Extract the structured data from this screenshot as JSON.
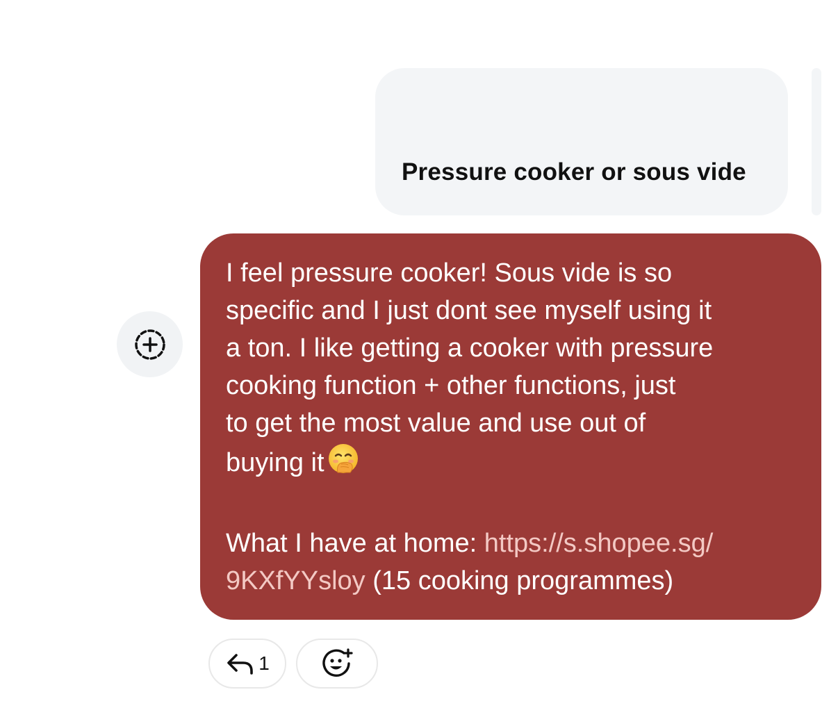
{
  "quoted_message": {
    "text": "Pressure cooker or sous vide"
  },
  "message": {
    "paragraph1_lines": [
      "I feel pressure cooker! Sous vide is so",
      "specific and I just dont see myself using it",
      "a ton. I like getting a cooker with pressure",
      "cooking function + other functions, just",
      "to get the most value and use out of"
    ],
    "paragraph1_last": "buying it",
    "emoji": "face-with-hand-over-mouth-emoji",
    "paragraph2_prefix": "What I have at home: ",
    "link_line1": "https://s.shopee.sg/",
    "link_line2": "9KXfYYsloy",
    "paragraph2_suffix": " (15 cooking programmes)",
    "bubble_color": "#9b3a37",
    "link_color": "#f3c9c4"
  },
  "actions": {
    "reply_count": "1",
    "reply_icon": "reply-arrow-icon",
    "react_icon": "add-emoji-icon",
    "add_icon": "dashed-circle-plus-icon"
  }
}
